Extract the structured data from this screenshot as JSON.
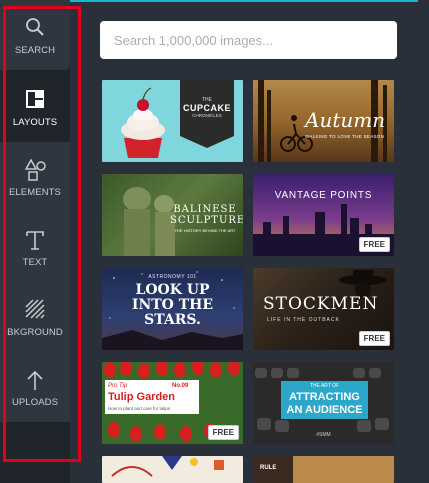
{
  "sidebar": {
    "items": [
      {
        "label": "SEARCH",
        "icon": "search-icon",
        "active": false
      },
      {
        "label": "LAYOUTS",
        "icon": "layouts-icon",
        "active": true
      },
      {
        "label": "ELEMENTS",
        "icon": "elements-icon",
        "active": false
      },
      {
        "label": "TEXT",
        "icon": "text-icon",
        "active": false
      },
      {
        "label": "BKGROUND",
        "icon": "background-icon",
        "active": false
      },
      {
        "label": "UPLOADS",
        "icon": "uploads-icon",
        "active": false
      }
    ]
  },
  "search": {
    "placeholder": "Search 1,000,000 images..."
  },
  "colors": {
    "accent": "#1bb5c9",
    "highlight": "#e3001b",
    "panel": "#293039",
    "sidebar": "#20252c"
  },
  "templates": [
    {
      "lines": [
        "THE",
        "CUPCAKE",
        "CHRONICLES"
      ],
      "free": false
    },
    {
      "lines": [
        "Autumn",
        "WALKING TO LOVE THE SEASON"
      ],
      "free": false
    },
    {
      "lines": [
        "BALINESE",
        "SCULPTURE",
        "THE HISTORY BEHIND THE ART"
      ],
      "free": false
    },
    {
      "lines": [
        "VANTAGE POINTS"
      ],
      "free": true
    },
    {
      "lines": [
        "ASTRONOMY 101",
        "LOOK UP",
        "INTO THE",
        "STARS."
      ],
      "free": false
    },
    {
      "lines": [
        "STOCKMEN",
        "LIFE IN THE OUTBACK"
      ],
      "free": true
    },
    {
      "lines": [
        "Pro Tip",
        "No.09",
        "Tulip Garden",
        "How to plant and care for tulips"
      ],
      "free": true
    },
    {
      "lines": [
        "THE ART OF",
        "ATTRACTING",
        "AN AUDIENCE",
        "#SMM"
      ],
      "free": false
    },
    {
      "lines": [],
      "free": false
    },
    {
      "lines": [
        "RULE"
      ],
      "free": false
    }
  ],
  "free_label": "FREE"
}
